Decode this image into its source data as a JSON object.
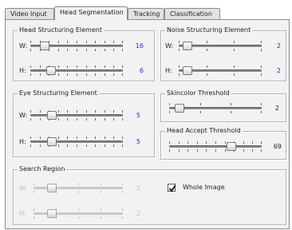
{
  "tabs": [
    {
      "label": "Video Input"
    },
    {
      "label": "Head Segmentation"
    },
    {
      "label": "Tracking"
    },
    {
      "label": "Classification"
    }
  ],
  "groups": {
    "head_structuring": {
      "title": "Head Structuring Element",
      "w_label": "W:",
      "w_value": "16",
      "h_label": "H:",
      "h_value": "6"
    },
    "noise_structuring": {
      "title": "Noise Structuring Element",
      "w_label": "W:",
      "w_value": "2",
      "h_label": "H:",
      "h_value": "2"
    },
    "eye_structuring": {
      "title": "Eye Structuring Element",
      "w_label": "W:",
      "w_value": "5",
      "h_label": "H:",
      "h_value": "5"
    },
    "skincolor": {
      "title": "Skincolor Threshold",
      "value": "2"
    },
    "head_accept": {
      "title": "Head Accept Threshold",
      "value": "69"
    },
    "search_region": {
      "title": "Search Region",
      "w_label": "W:",
      "w_value": "2",
      "h_label": "H:",
      "h_value": "2"
    }
  },
  "whole_image": {
    "label": "Whole Image",
    "checked": true
  },
  "sliders": {
    "head_w": 0.12,
    "head_h": 0.19,
    "noise_w": 0.05,
    "noise_h": 0.05,
    "eye_w": 0.2,
    "eye_h": 0.2,
    "skin": 0.07,
    "accept": 0.69,
    "search_w": 0.17,
    "search_h": 0.17
  },
  "colors": {
    "value_blue": "#2a2ad4",
    "panel": "#f2f2f2"
  }
}
